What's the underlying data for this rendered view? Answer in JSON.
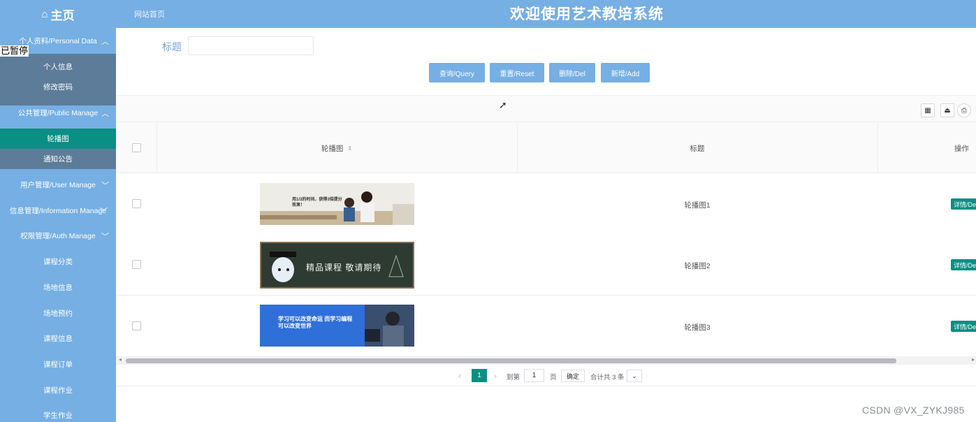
{
  "header": {
    "logo_icon": "home-icon",
    "logo_text": "主页",
    "home_link": "网站首页",
    "system_title": "欢迎使用艺术教培系统"
  },
  "overlay_text": "已暂停",
  "sidebar": {
    "group_personal": "个人资料/Personal Data",
    "personal_items": [
      "个人信息",
      "修改密码"
    ],
    "group_public": "公共管理/Public Manage",
    "public_items": [
      "轮播图",
      "通知公告"
    ],
    "group_user": "用户管理/User Manage",
    "group_info": "信息管理/Information Manage",
    "group_auth": "权限管理/Auth Manage",
    "leaf_items": [
      "课程分类",
      "场地信息",
      "场地预约",
      "课程信息",
      "课程订单",
      "课程作业",
      "学生作业"
    ]
  },
  "search": {
    "label": "标题",
    "value": ""
  },
  "buttons": {
    "query": "查询/Query",
    "reset": "重置/Reset",
    "delete": "删除/Del",
    "add": "新增/Add"
  },
  "toolbar_icons": [
    "columns-icon",
    "export-icon",
    "print-icon"
  ],
  "table": {
    "columns": [
      "轮播图",
      "标题",
      "操作"
    ],
    "rows": [
      {
        "title": "轮播图1",
        "action": "详情/Detail",
        "banner_text": "用1/3的时间，获得3倍提分效果！"
      },
      {
        "title": "轮播图2",
        "action": "详情/Detail",
        "banner_text": "精品课程 敬请期待"
      },
      {
        "title": "轮播图3",
        "action": "详情/Detail",
        "banner_text": "学习可以改变命运 而学习编程可以改变世界"
      }
    ]
  },
  "pagination": {
    "current_page": "1",
    "goto_label": "到第",
    "goto_value": "1",
    "page_label": "页",
    "confirm": "确定",
    "total": "合计共 3 条"
  },
  "watermark": "CSDN @VX_ZYKJ985",
  "colors": {
    "primary": "#76afe3",
    "accent": "#0a8f84",
    "submenu_dark": "#5d7c99"
  }
}
